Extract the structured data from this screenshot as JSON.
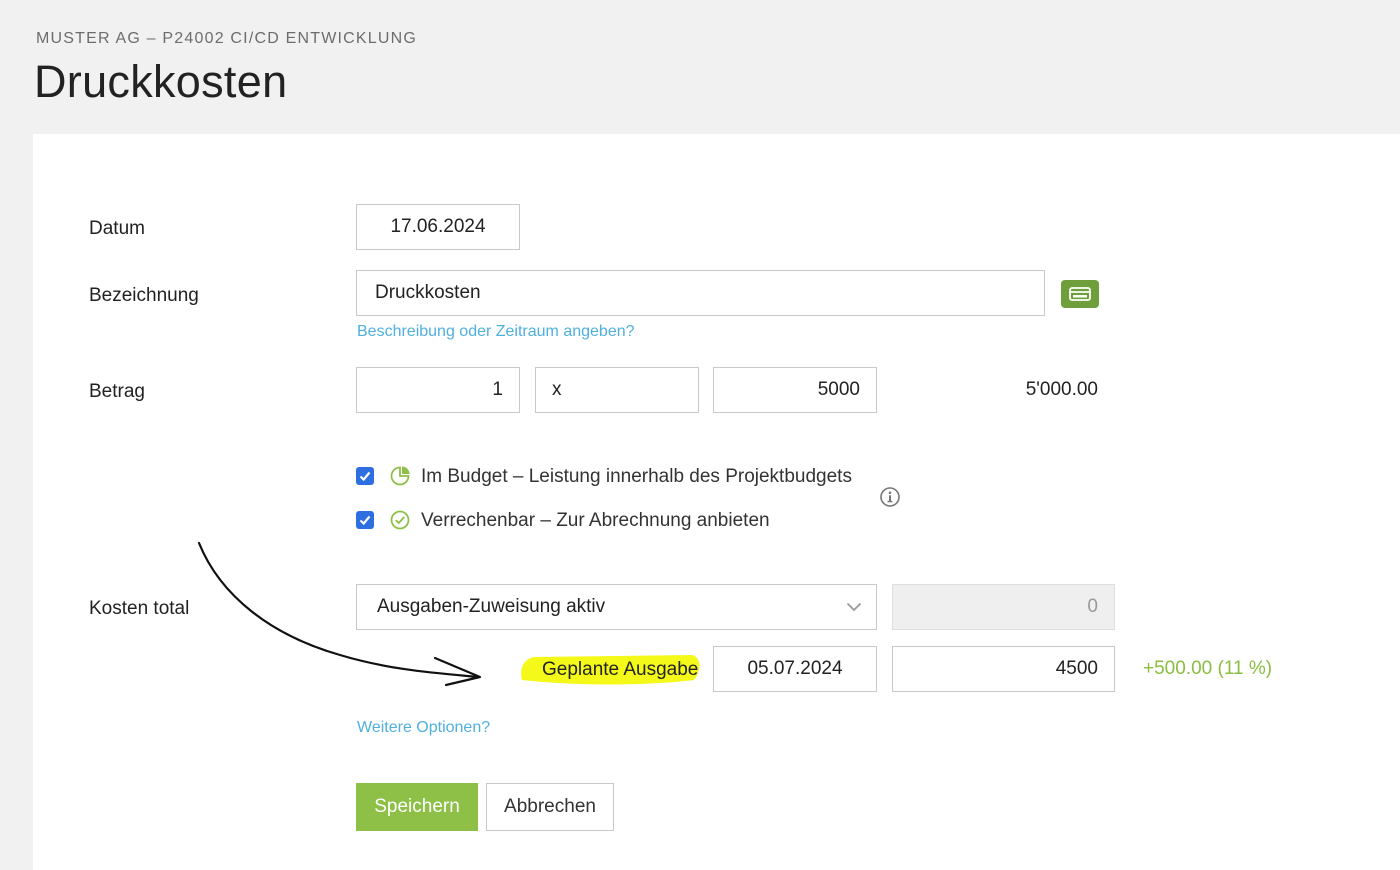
{
  "header": {
    "breadcrumb": "MUSTER AG – P24002 CI/CD ENTWICKLUNG",
    "title": "Druckkosten"
  },
  "form": {
    "datum": {
      "label": "Datum",
      "value": "17.06.2024"
    },
    "bezeichnung": {
      "label": "Bezeichnung",
      "value": "Druckkosten",
      "link": "Beschreibung oder Zeitraum angeben?"
    },
    "betrag": {
      "label": "Betrag",
      "quantity": "1",
      "unit": "x",
      "price": "5000",
      "total": "5'000.00"
    },
    "checkboxes": [
      {
        "checked": true,
        "text": "Im Budget – Leistung innerhalb des Projektbudgets",
        "icon": "pie-chart-icon"
      },
      {
        "checked": true,
        "text": "Verrechenbar – Zur Abrechnung anbieten",
        "icon": "check-circle-icon"
      }
    ],
    "kosten_total": {
      "label": "Kosten total",
      "select_value": "Ausgaben-Zuweisung aktiv",
      "disabled_value": "0",
      "planned_label": "Geplante Ausgabe",
      "planned_date": "05.07.2024",
      "planned_amount": "4500",
      "difference": "+500.00 (11 %)"
    },
    "more_options": "Weitere Optionen?"
  },
  "buttons": {
    "save": "Speichern",
    "cancel": "Abbrechen"
  },
  "colors": {
    "accent_green": "#8ebf47",
    "link_blue": "#4fb0de",
    "checkbox_blue": "#2d6fe0",
    "highlight_yellow": "#f4f91a"
  }
}
